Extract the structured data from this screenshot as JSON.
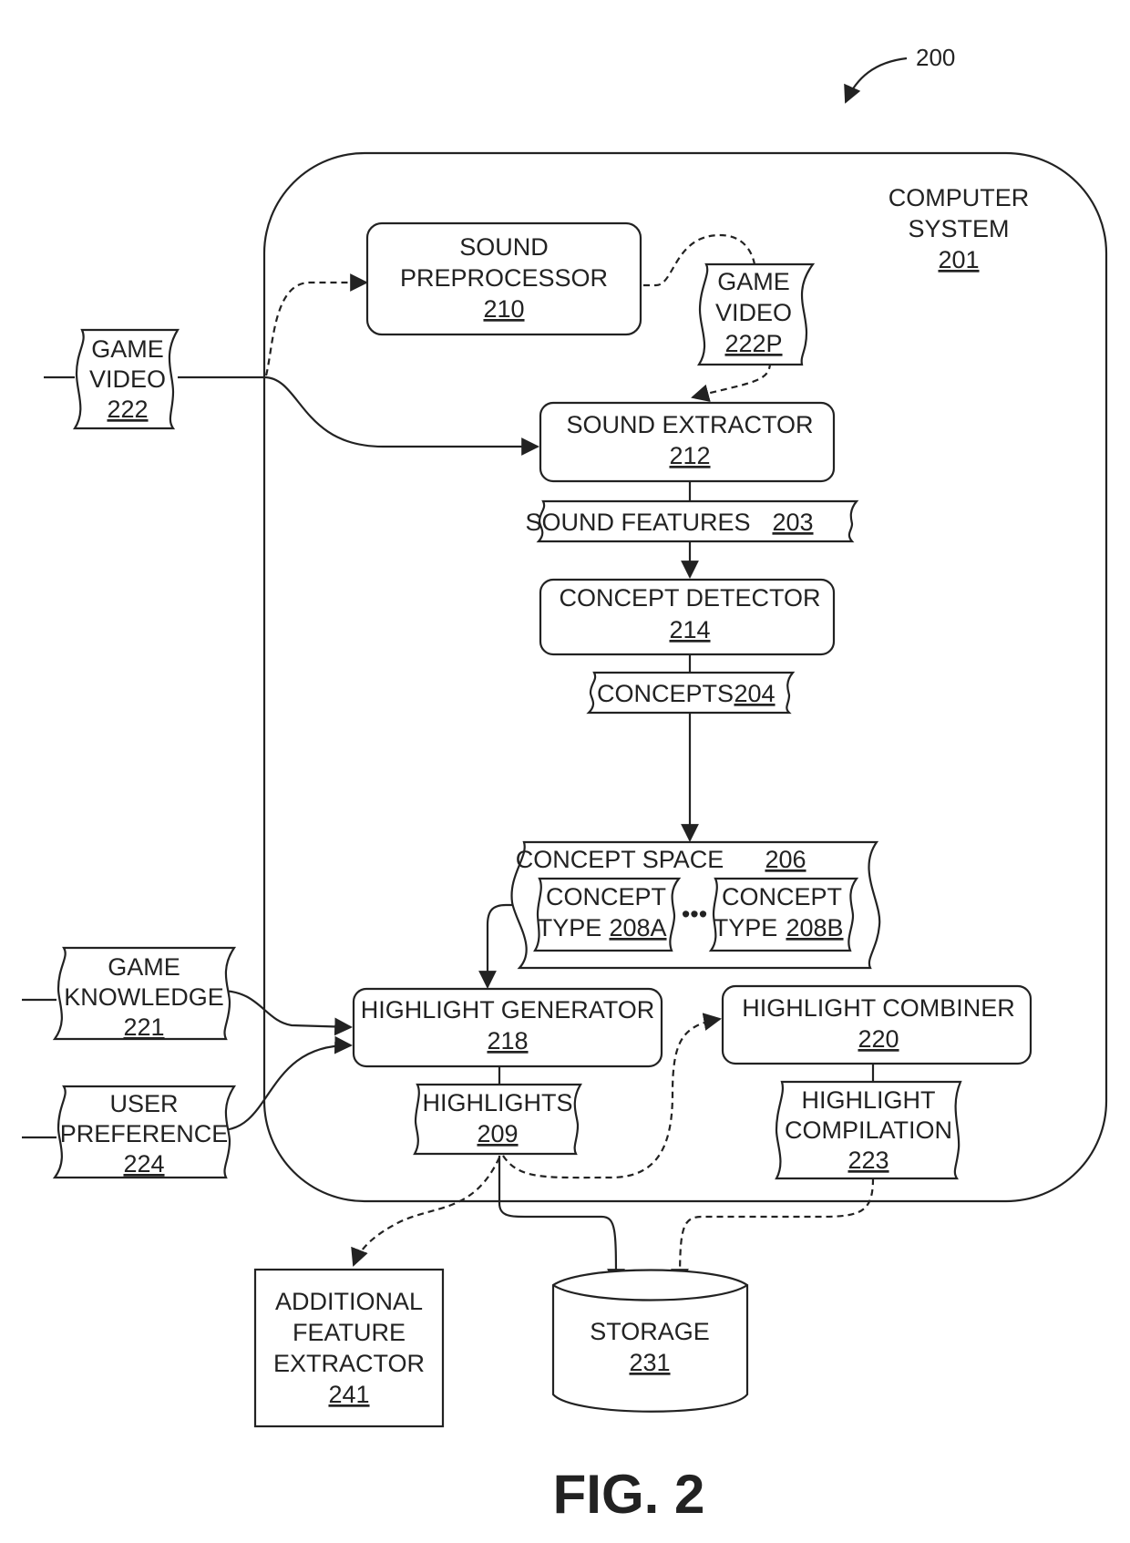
{
  "figure": {
    "ref": "200",
    "caption": "FIG. 2"
  },
  "system": {
    "line1": "COMPUTER",
    "line2": "SYSTEM",
    "num": "201"
  },
  "nodes": {
    "sound_preprocessor": {
      "line1": "SOUND",
      "line2": "PREPROCESSOR",
      "num": "210"
    },
    "game_video_p": {
      "line1": "GAME",
      "line2": "VIDEO",
      "num": "222P"
    },
    "game_video": {
      "line1": "GAME",
      "line2": "VIDEO",
      "num": "222"
    },
    "sound_extractor": {
      "line1": "SOUND EXTRACTOR",
      "num": "212"
    },
    "sound_features": {
      "line1": "SOUND FEATURES",
      "num": "203"
    },
    "concept_detector": {
      "line1": "CONCEPT DETECTOR",
      "num": "214"
    },
    "concepts": {
      "line1": "CONCEPTS",
      "num": "204"
    },
    "concept_space": {
      "line1": "CONCEPT SPACE",
      "num": "206"
    },
    "concept_type_a": {
      "line1": "CONCEPT",
      "line2": "TYPE",
      "num": "208A"
    },
    "concept_type_b": {
      "line1": "CONCEPT",
      "line2": "TYPE",
      "num": "208B"
    },
    "ellipsis": "•••",
    "game_knowledge": {
      "line1": "GAME",
      "line2": "KNOWLEDGE",
      "num": "221"
    },
    "user_preference": {
      "line1": "USER",
      "line2": "PREFERENCE",
      "num": "224"
    },
    "highlight_generator": {
      "line1": "HIGHLIGHT GENERATOR",
      "num": "218"
    },
    "highlights": {
      "line1": "HIGHLIGHTS",
      "num": "209"
    },
    "highlight_combiner": {
      "line1": "HIGHLIGHT COMBINER",
      "num": "220"
    },
    "highlight_compilation": {
      "line1": "HIGHLIGHT",
      "line2": "COMPILATION",
      "num": "223"
    },
    "additional_feature_extractor": {
      "line1": "ADDITIONAL",
      "line2": "FEATURE",
      "line3": "EXTRACTOR",
      "num": "241"
    },
    "storage": {
      "line1": "STORAGE",
      "num": "231"
    }
  }
}
